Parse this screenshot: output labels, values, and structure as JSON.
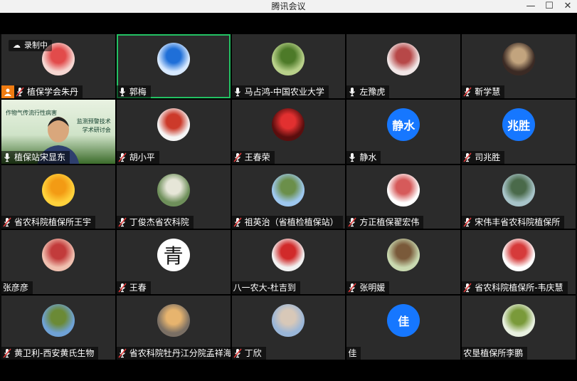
{
  "window": {
    "title": "腾讯会议",
    "controls": {
      "minimize": "—",
      "maximize": "☐",
      "close": "✕"
    }
  },
  "recording_label": "录制中",
  "shared_slide": {
    "line1": "作物气传流行性病害",
    "line2": "监测预警技术",
    "line3": "学术研讨会"
  },
  "participants": [
    {
      "name": "植保学会朱丹",
      "mic": "muted",
      "avatar": "photo",
      "colors": [
        "#f6d7d2",
        "#e24b4b"
      ]
    },
    {
      "name": "郭梅",
      "mic": "on",
      "avatar": "photo",
      "colors": [
        "#d7e9ff",
        "#1f6fd8"
      ],
      "active": true
    },
    {
      "name": "马占鸿-中国农业大学",
      "mic": "on",
      "avatar": "photo",
      "colors": [
        "#b8d08a",
        "#4d7a28"
      ]
    },
    {
      "name": "左豫虎",
      "mic": "on",
      "avatar": "photo",
      "colors": [
        "#f1e6e6",
        "#b74848"
      ]
    },
    {
      "name": "靳学慧",
      "mic": "muted",
      "avatar": "photo",
      "colors": [
        "#3b2a24",
        "#c2a47e"
      ]
    },
    {
      "name": "植保站宋显东",
      "mic": "on",
      "avatar": "screenshare"
    },
    {
      "name": "胡小平",
      "mic": "muted",
      "avatar": "photo",
      "colors": [
        "#f5f5f5",
        "#cc3a2a"
      ]
    },
    {
      "name": "王春荣",
      "mic": "muted",
      "avatar": "photo",
      "colors": [
        "#5a0e0e",
        "#e23030"
      ]
    },
    {
      "name": "静水",
      "mic": "on",
      "avatar": "letter",
      "letter": "静水"
    },
    {
      "name": "司兆胜",
      "mic": "muted",
      "avatar": "letter",
      "letter": "兆胜"
    },
    {
      "name": "省农科院植保所王宇",
      "mic": "muted",
      "avatar": "photo",
      "colors": [
        "#ffd23c",
        "#f39b14"
      ]
    },
    {
      "name": "丁俊杰省农科院",
      "mic": "muted",
      "avatar": "photo",
      "colors": [
        "#6e8f5a",
        "#e6e6d8"
      ]
    },
    {
      "name": "祖英治（省植检植保站）",
      "mic": "muted",
      "avatar": "photo",
      "colors": [
        "#9ec8ef",
        "#6b8f4a"
      ]
    },
    {
      "name": "方正植保翟宏伟",
      "mic": "muted",
      "avatar": "photo",
      "colors": [
        "#ffffff",
        "#d65a5a"
      ]
    },
    {
      "name": "宋伟丰省农科院植保所",
      "mic": "muted",
      "avatar": "photo",
      "colors": [
        "#a8c4c9",
        "#4a6a4a"
      ]
    },
    {
      "name": "张彦彦",
      "mic": "none",
      "avatar": "photo",
      "colors": [
        "#f0c0b0",
        "#c23b3b"
      ]
    },
    {
      "name": "王春",
      "mic": "muted",
      "avatar": "chun",
      "letter": "青"
    },
    {
      "name": "八一农大-杜吉到",
      "mic": "none",
      "avatar": "photo",
      "colors": [
        "#f2f2f2",
        "#d12a2a"
      ]
    },
    {
      "name": "张明媛",
      "mic": "muted",
      "avatar": "photo",
      "colors": [
        "#c9d9b0",
        "#7a5a3a"
      ]
    },
    {
      "name": "省农科院植保所-韦庆慧",
      "mic": "muted",
      "avatar": "photo",
      "colors": [
        "#ffffff",
        "#d63a3a"
      ]
    },
    {
      "name": "黄卫利-西安黄氏生物",
      "mic": "muted",
      "avatar": "photo",
      "colors": [
        "#6fa2d6",
        "#6b8a36"
      ]
    },
    {
      "name": "省农科院牡丹江分院孟祥海",
      "mic": "muted",
      "avatar": "photo",
      "colors": [
        "#7a6f64",
        "#e7b46e"
      ]
    },
    {
      "name": "丁欣",
      "mic": "muted",
      "avatar": "photo",
      "colors": [
        "#9ab6d8",
        "#d8c8b8"
      ]
    },
    {
      "name": "佳",
      "mic": "none",
      "avatar": "letter",
      "letter": "佳"
    },
    {
      "name": "农垦植保所李鹏",
      "mic": "none",
      "avatar": "photo",
      "colors": [
        "#e8f0e0",
        "#7a9a3a"
      ]
    }
  ],
  "colors": {
    "active_border": "#23c163",
    "mic_on": "#ffffff",
    "mic_muted_slash": "#e23b3b",
    "host_badge": "#f07c12",
    "letter_avatar": "#1677ff"
  }
}
